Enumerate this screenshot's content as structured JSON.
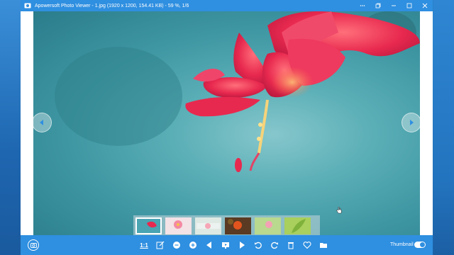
{
  "window": {
    "title": "Apowersoft Photo Viewer - 1.jpg (1920 x 1200, 154.41 KB) - 59 %, 1/6"
  },
  "icons": {
    "app": "app-logo-icon",
    "minimize": "minimize-icon",
    "maximize": "maximize-icon",
    "close": "close-icon",
    "more": "more-icon",
    "restore": "restore-icon"
  },
  "toolbar": {
    "ratio_label": "1:1",
    "thumbnail_label": "Thumbnail",
    "thumbnail_enabled": true
  },
  "thumbnails": [
    {
      "name": "red-flower",
      "active": true,
      "color": "#4aa4b2"
    },
    {
      "name": "pink-flower",
      "active": false,
      "color": "#f3e2e6"
    },
    {
      "name": "white-blossom",
      "active": false,
      "color": "#dfe9e4"
    },
    {
      "name": "orange-bokeh",
      "active": false,
      "color": "#5a3a22"
    },
    {
      "name": "pink-on-green",
      "active": false,
      "color": "#b9d98e"
    },
    {
      "name": "green-leaves",
      "active": false,
      "color": "#a9cf5c"
    }
  ],
  "colors": {
    "accent": "#2f8fe0",
    "photo_bg": "#4aa0ad",
    "flower": "#e8294f"
  }
}
